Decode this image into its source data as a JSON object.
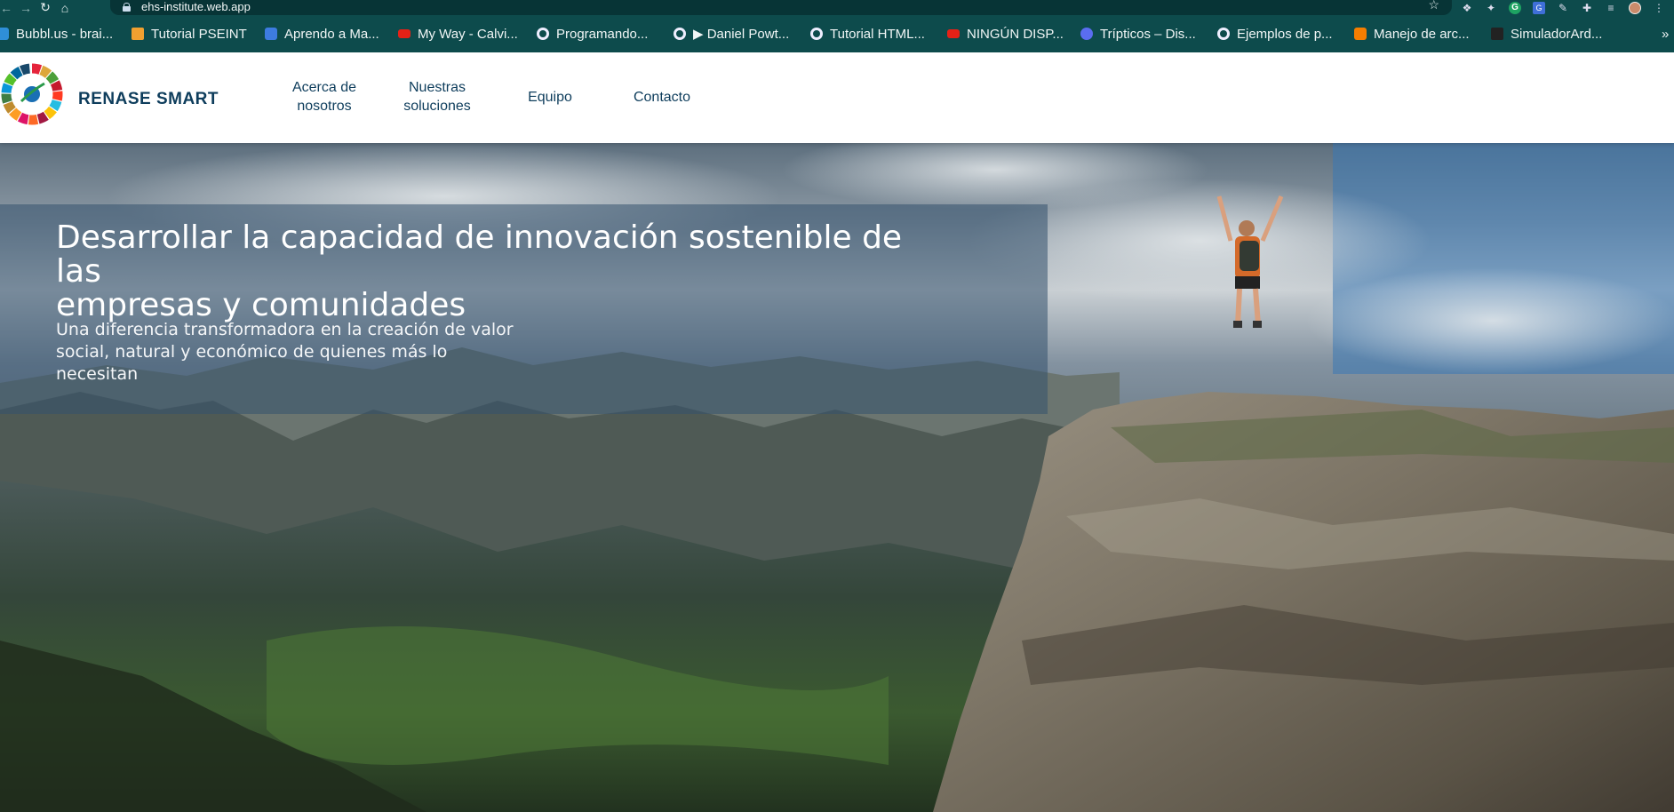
{
  "browser": {
    "url": "ehs-institute.web.app",
    "bookmarks": [
      {
        "label": "Bubbl.us - brai...",
        "icon": "bubbl-icon"
      },
      {
        "label": "Tutorial PSEINT",
        "icon": "pseint-icon"
      },
      {
        "label": "Aprendo a Ma...",
        "icon": "car-icon"
      },
      {
        "label": "My Way - Calvi...",
        "icon": "youtube-icon"
      },
      {
        "label": "Programando...",
        "icon": "globe-icon"
      },
      {
        "label": "▶ Daniel Powt...",
        "icon": "globe-icon"
      },
      {
        "label": "Tutorial HTML...",
        "icon": "globe-icon"
      },
      {
        "label": "NINGÚN DISP...",
        "icon": "youtube-icon"
      },
      {
        "label": "Trípticos – Dis...",
        "icon": "c-icon"
      },
      {
        "label": "Ejemplos de p...",
        "icon": "globe-icon"
      },
      {
        "label": "Manejo de arc...",
        "icon": "blogger-icon"
      },
      {
        "label": "SimuladorArd...",
        "icon": "sim-icon"
      }
    ],
    "overflow_label": "»"
  },
  "site": {
    "brand": "RENASE SMART",
    "menu": [
      {
        "line1": "Acerca de",
        "line2": "nosotros"
      },
      {
        "line1": "Nuestras",
        "line2": "soluciones"
      },
      {
        "line1": "Equipo",
        "line2": ""
      },
      {
        "line1": "Contacto",
        "line2": ""
      }
    ]
  },
  "hero": {
    "title_line1": "Desarrollar la capacidad de innovación sostenible de las",
    "title_line2": "empresas y comunidades",
    "subtitle_line1": "Una diferencia transformadora en la creación de valor",
    "subtitle_line2": "social, natural y económico de quienes más lo",
    "subtitle_line3": "necesitan"
  },
  "colors": {
    "browser_bar": "#0d4b4c",
    "brand_text": "#0e3d5c",
    "overlay": "rgba(52,82,110,0.55)"
  }
}
